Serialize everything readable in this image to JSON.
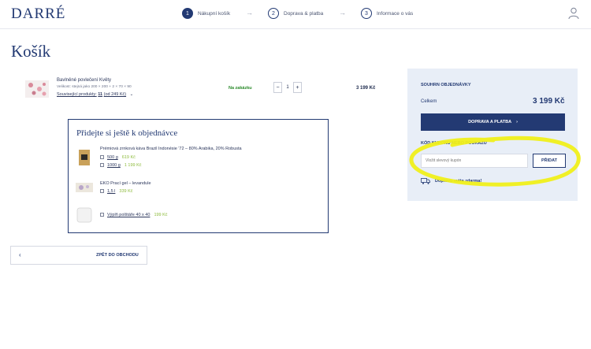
{
  "header": {
    "logo": "DARRÉ",
    "steps": [
      {
        "num": "1",
        "label": "Nákupní košík"
      },
      {
        "num": "2",
        "label": "Doprava & platba"
      },
      {
        "num": "3",
        "label": "Informace o vás"
      }
    ]
  },
  "page_title": "Košík",
  "cart_item": {
    "name": "Bavlněné povlečení Květy",
    "size": "Velikost: stejná jako 200 × 200 + 2 × 70 × 90",
    "related_prefix": "Související produkty:",
    "related_count": "11",
    "related_from": "(od 249 Kč)",
    "stock": "Na zakázku",
    "qty_minus": "−",
    "quantity": "1",
    "qty_plus": "+",
    "price": "3 199 Kč"
  },
  "upsell": {
    "title": "Přidejte si ještě k objednávce",
    "products": [
      {
        "name": "Prémiová zrnková káva Brazil Indonésie '72 – 80% Arabika, 20% Robusta",
        "options": [
          {
            "size": "500 g",
            "price": "619 Kč"
          },
          {
            "size": "1000 g",
            "price": "1 199 Kč"
          }
        ]
      },
      {
        "name": "EKO Prací gel – levandule",
        "options": [
          {
            "size": "1,5 l",
            "price": "339 Kč"
          }
        ]
      },
      {
        "name": "",
        "options": [
          {
            "size": "Výplň polštáře 40 x 40",
            "price": "199 Kč"
          }
        ]
      }
    ]
  },
  "back_label": "ZPĚT DO OBCHODU",
  "summary": {
    "title": "SOUHRN OBJEDNÁVKY",
    "total_label": "Celkem",
    "total": "3 199 Kč",
    "checkout_label": "DOPRAVA A PLATBA",
    "coupon_title": "KÓD KUPONU NEBO POUKAZU",
    "coupon_placeholder": "Vložit slevový kupón",
    "coupon_button": "PŘIDAT",
    "free_shipping": "Dopravu máte zdarma!"
  },
  "colors": {
    "brand": "#233a73",
    "price_green": "#8dbb3c",
    "highlight": "#f0ef1a"
  }
}
